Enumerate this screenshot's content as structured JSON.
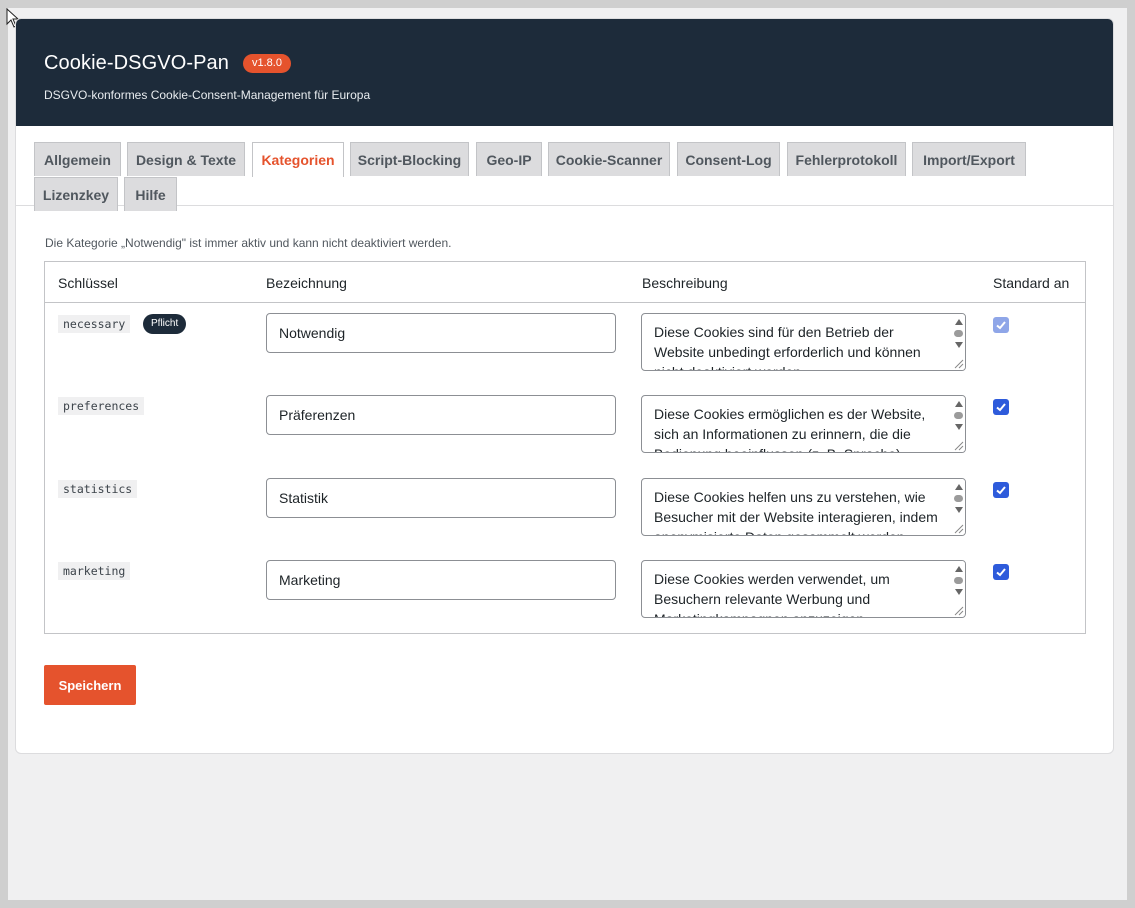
{
  "header": {
    "title": "Cookie-DSGVO-Pan",
    "version": "v1.8.0",
    "subtitle": "DSGVO-konformes Cookie-Consent-Management für Europa"
  },
  "tabs": [
    {
      "label": "Allgemein",
      "active": false
    },
    {
      "label": "Design & Texte",
      "active": false
    },
    {
      "label": "Kategorien",
      "active": true
    },
    {
      "label": "Script-Blocking",
      "active": false
    },
    {
      "label": "Geo-IP",
      "active": false
    },
    {
      "label": "Cookie-Scanner",
      "active": false
    },
    {
      "label": "Consent-Log",
      "active": false
    },
    {
      "label": "Fehlerprotokoll",
      "active": false
    },
    {
      "label": "Import/Export",
      "active": false
    },
    {
      "label": "Lizenzkey",
      "active": false
    },
    {
      "label": "Hilfe",
      "active": false
    }
  ],
  "notice": "Die Kategorie „Notwendig\" ist immer aktiv und kann nicht deaktiviert werden.",
  "table": {
    "headers": {
      "key": "Schlüssel",
      "name": "Bezeichnung",
      "description": "Beschreibung",
      "default_on": "Standard an"
    },
    "rows": [
      {
        "key": "necessary",
        "badge": "Pflicht",
        "name": "Notwendig",
        "description": "Diese Cookies sind für den Betrieb der Website unbedingt erforderlich und können nicht deaktiviert werden.",
        "default_on": true,
        "disabled": true
      },
      {
        "key": "preferences",
        "badge": "",
        "name": "Präferenzen",
        "description": "Diese Cookies ermöglichen es der Website, sich an Informationen zu erinnern, die die Bedienung beeinflussen (z. B. Sprache).",
        "default_on": true,
        "disabled": false
      },
      {
        "key": "statistics",
        "badge": "",
        "name": "Statistik",
        "description": "Diese Cookies helfen uns zu verstehen, wie Besucher mit der Website interagieren, indem anonymisierte Daten gesammelt werden.",
        "default_on": true,
        "disabled": false
      },
      {
        "key": "marketing",
        "badge": "",
        "name": "Marketing",
        "description": "Diese Cookies werden verwendet, um Besuchern relevante Werbung und Marketingkampagnen anzuzeigen.",
        "default_on": true,
        "disabled": false
      }
    ]
  },
  "save_label": "Speichern",
  "colors": {
    "header_bg": "#1d2b3a",
    "accent": "#e5532d",
    "checkbox": "#2e5bdb"
  }
}
